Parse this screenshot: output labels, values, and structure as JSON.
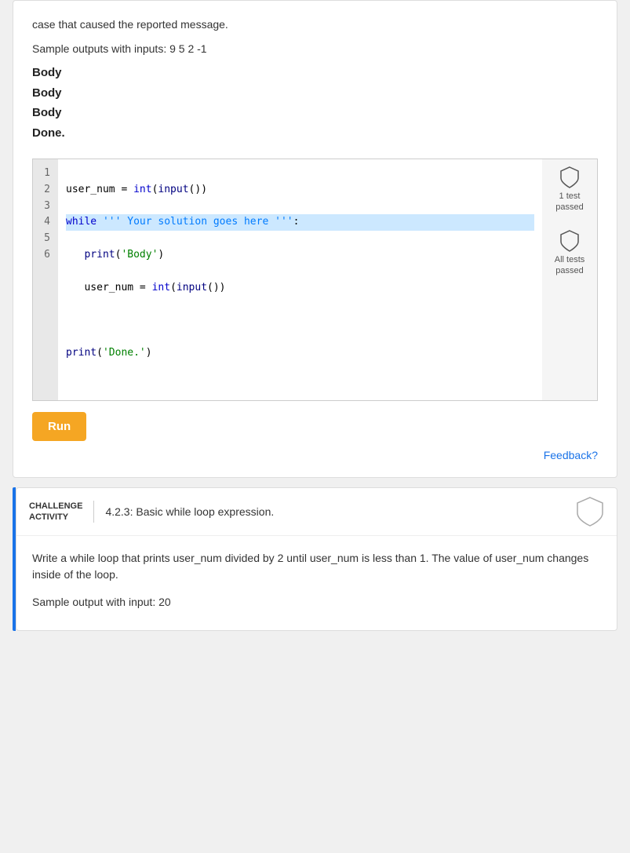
{
  "top_card": {
    "description": "case that caused the reported message.",
    "sample_label": "Sample outputs with inputs: 9 5 2 -1",
    "sample_output_lines": [
      "Body",
      "Body",
      "Body",
      "Done."
    ],
    "code_lines": [
      {
        "num": 1,
        "text": "user_num = int(input())",
        "highlighted": false
      },
      {
        "num": 2,
        "text": "while ''' Your solution goes here ''':",
        "highlighted": true
      },
      {
        "num": 3,
        "text": "   print('Body')",
        "highlighted": false
      },
      {
        "num": 4,
        "text": "   user_num = int(input())",
        "highlighted": false
      },
      {
        "num": 5,
        "text": "",
        "highlighted": false
      },
      {
        "num": 6,
        "text": "print('Done.')",
        "highlighted": false
      }
    ],
    "badges": [
      {
        "label": "1 test\npassed",
        "filled": false
      },
      {
        "label": "All tests\npassed",
        "filled": false
      }
    ],
    "run_button_label": "Run",
    "feedback_label": "Feedback?"
  },
  "challenge_card": {
    "tag_line1": "CHALLENGE",
    "tag_line2": "ACTIVITY",
    "title": "4.2.3: Basic while loop expression.",
    "body_text": "Write a while loop that prints user_num divided by 2 until user_num is less than 1. The value of user_num changes inside of the loop.",
    "sample_label": "Sample output with input: 20"
  }
}
